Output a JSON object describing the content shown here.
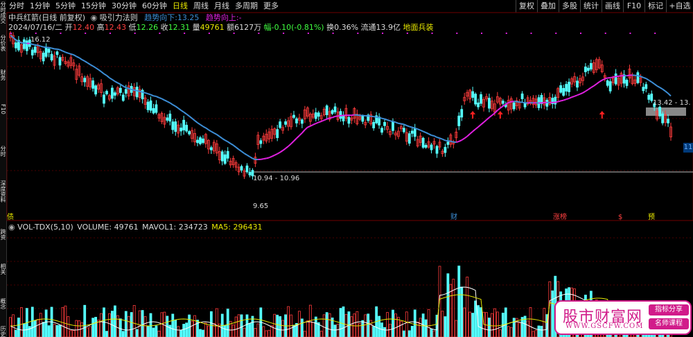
{
  "sidebar": {
    "labels": [
      "分时成交",
      "分价表",
      "财务",
      "F10",
      "分时",
      "深度资料",
      "跨资",
      "相关",
      "概念",
      "历史回溯"
    ]
  },
  "toolbar": {
    "periods": [
      "分时",
      "1分钟",
      "5分钟",
      "15分钟",
      "30分钟",
      "60分钟",
      "日线",
      "周线",
      "月线",
      "多周期",
      "更多"
    ],
    "active": "日线",
    "buttons": [
      "复权",
      "叠加",
      "多股",
      "统计",
      "画线",
      "F10",
      "标记",
      "+自选"
    ]
  },
  "header": {
    "stock": "中兵红箭(日线 前复权)",
    "indicator_icon": "circle-dot-icon",
    "indicator": "吸引力法则",
    "trend_down_label": "趋势向下:",
    "trend_down_value": "13.25",
    "trend_up_label": "趋势向上:",
    "trend_up_value": "-"
  },
  "quote": {
    "date": "2024/07/16/二",
    "open_label": "开",
    "open": "12.40",
    "high_label": "高",
    "high": "12.43",
    "low_label": "低",
    "low": "12.26",
    "close_label": "收",
    "close": "12.31",
    "vol_label": "量",
    "vol": "49761",
    "amount_label": "额",
    "amount": "6127万",
    "chg_label": "幅",
    "chg": "-0.10(-0.81%)",
    "turnover_label": "换",
    "turnover": "0.36%",
    "float_label": "流通",
    "float": "13.9亿",
    "extra": "地面兵装"
  },
  "annotations": {
    "high": "16.12",
    "low": "9.65",
    "range_left": "10.94 - 10.96",
    "range_right": "13.42 - 13."
  },
  "event_tags": [
    "债",
    "财",
    "涨榜",
    "$",
    "预"
  ],
  "volume": {
    "name": "VOL-TDX(5,10)",
    "volume_label": "VOLUME:",
    "volume": "49761",
    "mavol1_label": "MAVOL1:",
    "mavol1": "234723",
    "ma5_label": "MA5:",
    "ma5": "296431"
  },
  "right_tab": "11",
  "ad": {
    "brand": "股市财富网",
    "site": "WWW.GSCFW.COM",
    "tag1": "指标分享",
    "tag2": "名师课程"
  },
  "colors": {
    "up": "#ff3c3c",
    "down": "#54ffff",
    "ma_blue": "#3d8fd8",
    "ma_magenta": "#e020e0",
    "grid": "#500000",
    "yellow": "#e8e800"
  }
}
